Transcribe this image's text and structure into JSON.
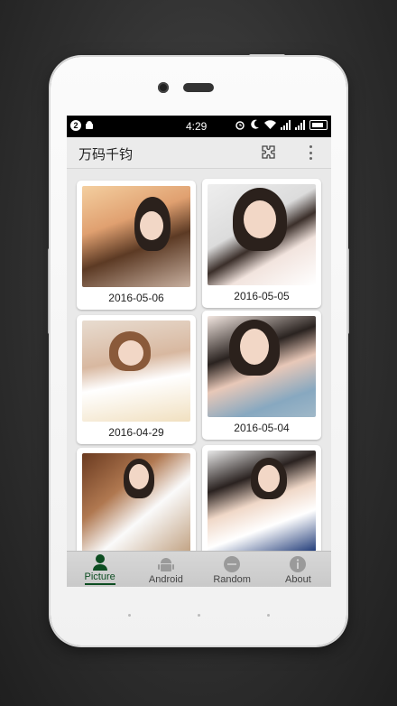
{
  "status_bar": {
    "notification_count": "2",
    "time": "4:29",
    "icons": [
      "alarm-icon",
      "moon-icon",
      "wifi-icon",
      "signal-icon",
      "signal-icon",
      "battery-icon"
    ]
  },
  "app_bar": {
    "title": "万码千钧",
    "actions": [
      "puzzle-icon",
      "overflow-menu-icon"
    ]
  },
  "gallery": {
    "items": [
      {
        "date": "2016-05-06"
      },
      {
        "date": "2016-05-05"
      },
      {
        "date": "2016-04-29"
      },
      {
        "date": "2016-05-04"
      },
      {
        "date": ""
      },
      {
        "date": ""
      }
    ]
  },
  "tabs": [
    {
      "label": "Picture",
      "icon": "person-icon",
      "active": true
    },
    {
      "label": "Android",
      "icon": "android-icon",
      "active": false
    },
    {
      "label": "Random",
      "icon": "random-icon",
      "active": false
    },
    {
      "label": "About",
      "icon": "info-icon",
      "active": false
    }
  ],
  "colors": {
    "accent": "#0d4d22",
    "tab_background": "#d0d0d0",
    "app_bar": "#ebebeb"
  }
}
